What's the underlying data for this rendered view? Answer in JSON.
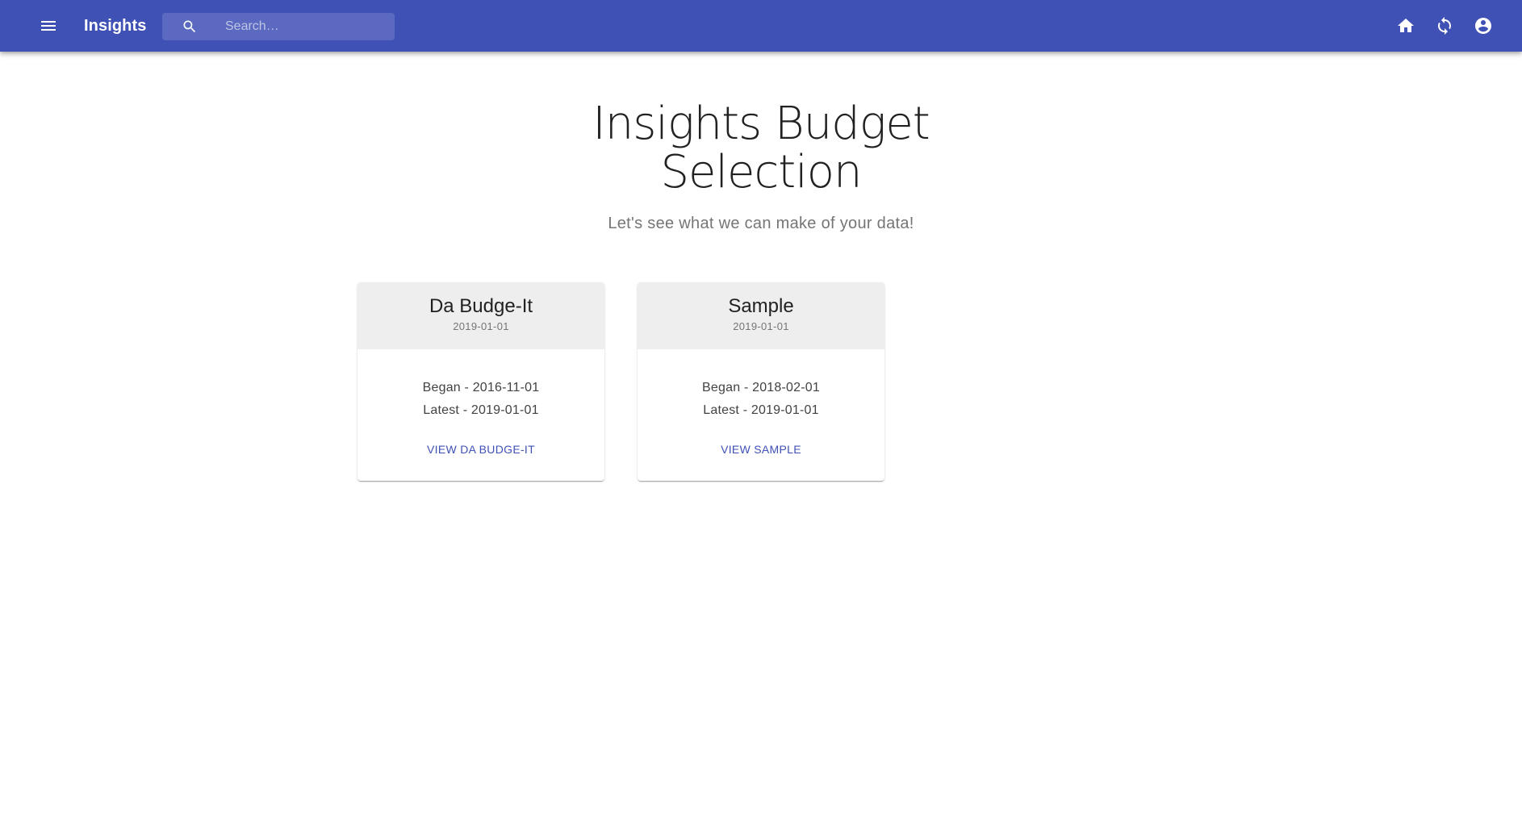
{
  "appbar": {
    "title": "Insights",
    "search_placeholder": "Search…",
    "icons": [
      "menu-icon",
      "search-icon",
      "home-icon",
      "sync-icon",
      "account-circle-icon"
    ]
  },
  "hero": {
    "title": "Insights Budget Selection",
    "subtitle": "Let's see what we can make of your data!"
  },
  "budgets": [
    {
      "title": "Da Budge-It",
      "date": "2019-01-01",
      "began": "Began - 2016-11-01",
      "latest": "Latest - 2019-01-01",
      "action": "VIEW DA BUDGE-IT"
    },
    {
      "title": "Sample",
      "date": "2019-01-01",
      "began": "Began - 2018-02-01",
      "latest": "Latest - 2019-01-01",
      "action": "VIEW SAMPLE"
    }
  ],
  "colors": {
    "primary": "#3f51b5",
    "card_header": "#eeeeee",
    "subtitle": "#757575"
  }
}
